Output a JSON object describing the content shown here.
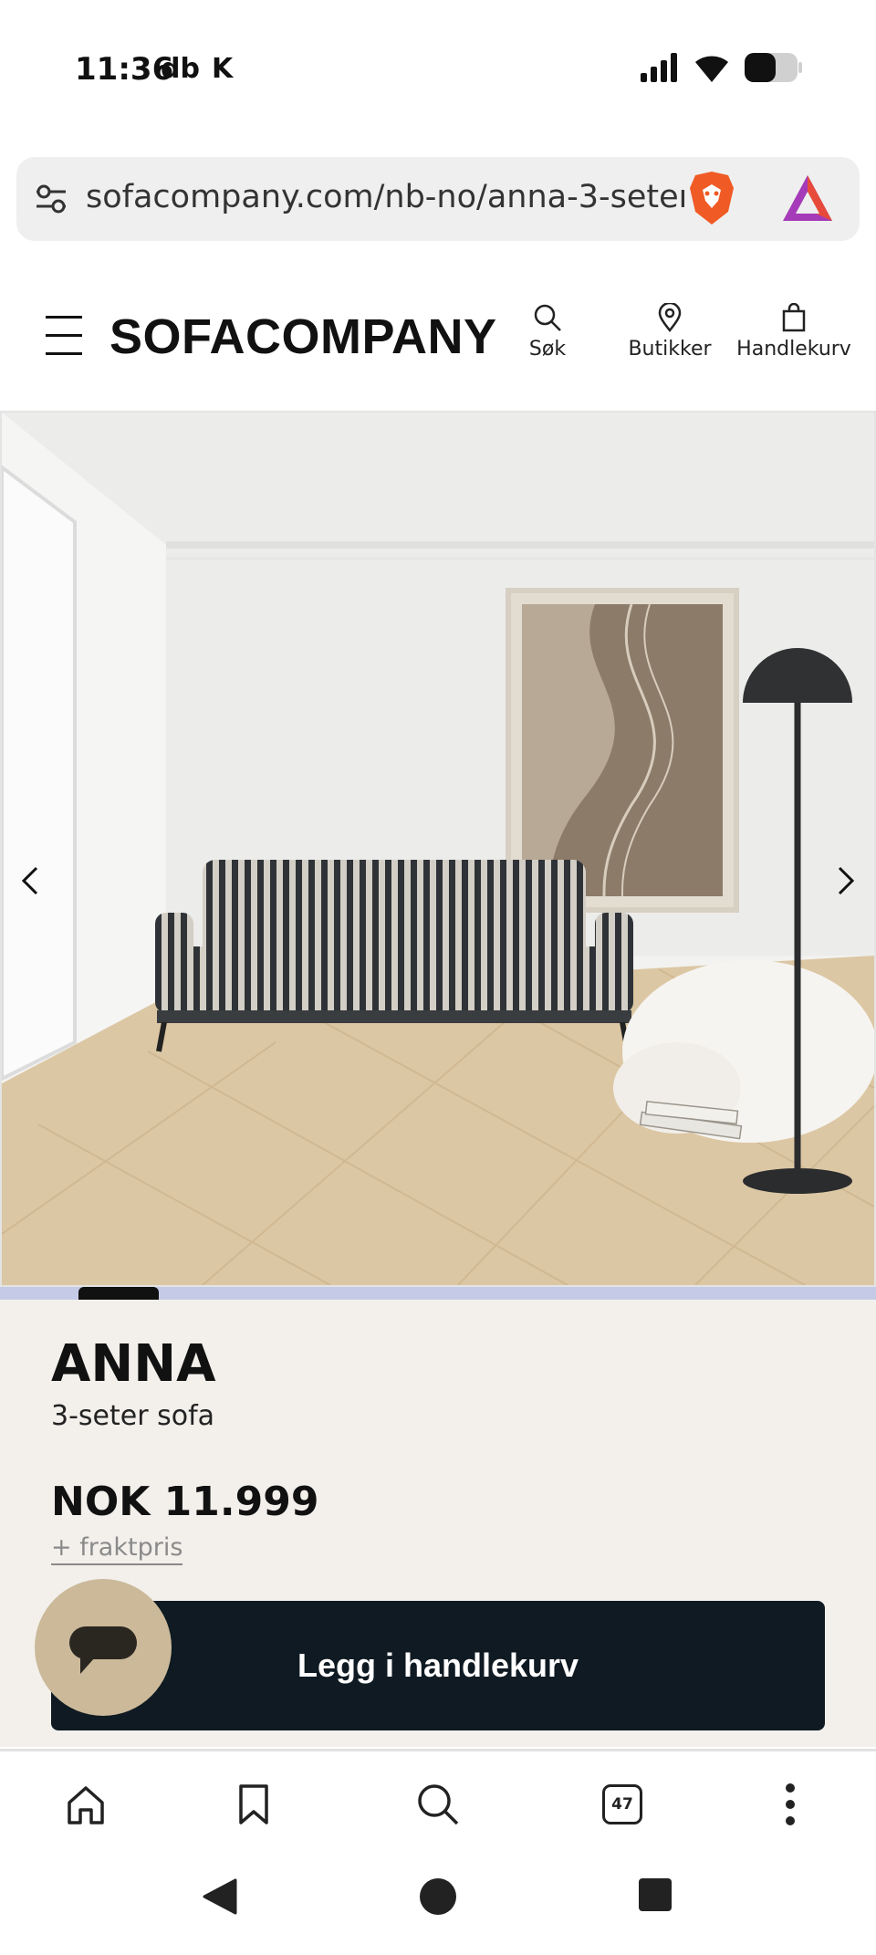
{
  "status_bar": {
    "time": "11:36",
    "app_icons": [
      "db",
      "K"
    ]
  },
  "browser": {
    "url": "sofacompany.com/nb-no/anna-3-seter",
    "tab_count": "47"
  },
  "site_header": {
    "logo": "SOFACOMPANY",
    "actions": [
      {
        "label": "Søk",
        "icon": "search-icon"
      },
      {
        "label": "Butikker",
        "icon": "location-pin-icon"
      },
      {
        "label": "Handlekurv",
        "icon": "shopping-bag-icon"
      }
    ]
  },
  "product": {
    "name": "ANNA",
    "type": "3-seter sofa",
    "price": "NOK 11.999",
    "shipping": "+ fraktpris",
    "cart_button": "Legg i handlekurv"
  },
  "colors": {
    "cart_button_bg": "#0f1a22",
    "panel_bg": "#f3f0ec",
    "chat_button_bg": "#cbb99a",
    "carousel_track": "#c5cbe6"
  }
}
